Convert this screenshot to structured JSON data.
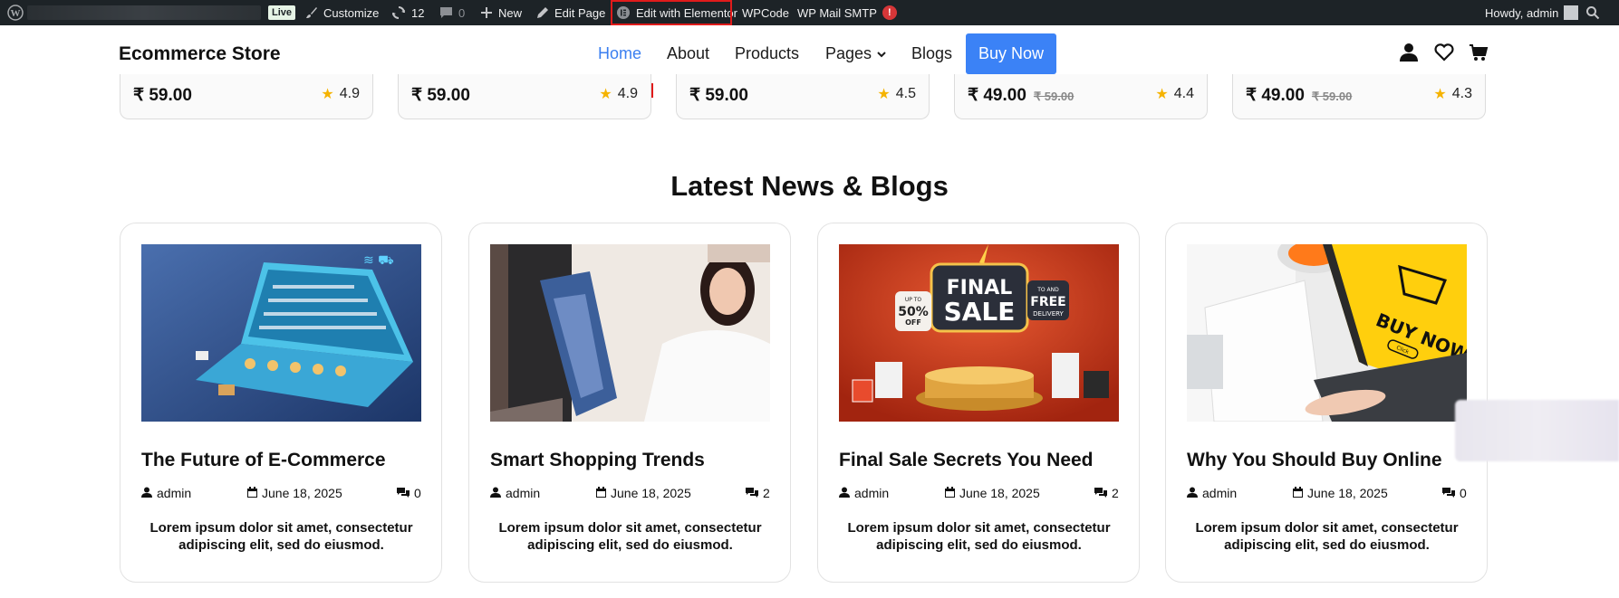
{
  "admin_bar": {
    "live": "Live",
    "customize": "Customize",
    "updates": "12",
    "comments": "0",
    "new": "New",
    "edit_page": "Edit Page",
    "edit_elementor": "Edit with Elementor",
    "wpcode": "WPCode",
    "wp_mail_smtp": "WP Mail SMTP",
    "smtp_alert": "!",
    "howdy": "Howdy, admin"
  },
  "header": {
    "brand": "Ecommerce Store",
    "nav": [
      "Home",
      "About",
      "Products",
      "Pages",
      "Blogs"
    ],
    "buy_now": "Buy Now"
  },
  "products": [
    {
      "price": "₹ 59.00",
      "old_price": "",
      "rating": "4.9"
    },
    {
      "price": "₹ 59.00",
      "old_price": "",
      "rating": "4.9"
    },
    {
      "price": "₹ 59.00",
      "old_price": "",
      "rating": "4.5"
    },
    {
      "price": "₹ 49.00",
      "old_price": "₹ 59.00",
      "rating": "4.4"
    },
    {
      "price": "₹ 49.00",
      "old_price": "₹ 59.00",
      "rating": "4.3"
    }
  ],
  "blogs_section": {
    "title": "Latest News & Blogs",
    "posts": [
      {
        "title": "The Future of E-Commerce",
        "author": "admin",
        "date": "June 18, 2025",
        "comments": "0",
        "excerpt": "Lorem ipsum dolor sit amet, consectetur adipiscing elit, sed do eiusmod."
      },
      {
        "title": "Smart Shopping Trends",
        "author": "admin",
        "date": "June 18, 2025",
        "comments": "2",
        "excerpt": "Lorem ipsum dolor sit amet, consectetur adipiscing elit, sed do eiusmod."
      },
      {
        "title": "Final Sale Secrets You Need",
        "author": "admin",
        "date": "June 18, 2025",
        "comments": "2",
        "excerpt": "Lorem ipsum dolor sit amet, consectetur adipiscing elit, sed do eiusmod."
      },
      {
        "title": "Why You Should Buy Online",
        "author": "admin",
        "date": "June 18, 2025",
        "comments": "0",
        "excerpt": "Lorem ipsum dolor sit amet, consectetur adipiscing elit, sed do eiusmod."
      }
    ]
  },
  "image_text": {
    "final_sale": [
      "FINAL",
      "SALE"
    ],
    "up_to": "UP TO",
    "fifty_off": "50%",
    "off": "OFF",
    "free_delivery_top": "TO AND",
    "free": "FREE",
    "delivery": "DELIVERY",
    "buy_now_screen": "BUY NOW",
    "click": "Click"
  },
  "colors": {
    "admin_bar_bg": "#1d2327",
    "accent_blue": "#3b82f6",
    "active_nav": "#3b7ff0",
    "star": "#f5b301",
    "highlight_red": "#e01b1b"
  }
}
